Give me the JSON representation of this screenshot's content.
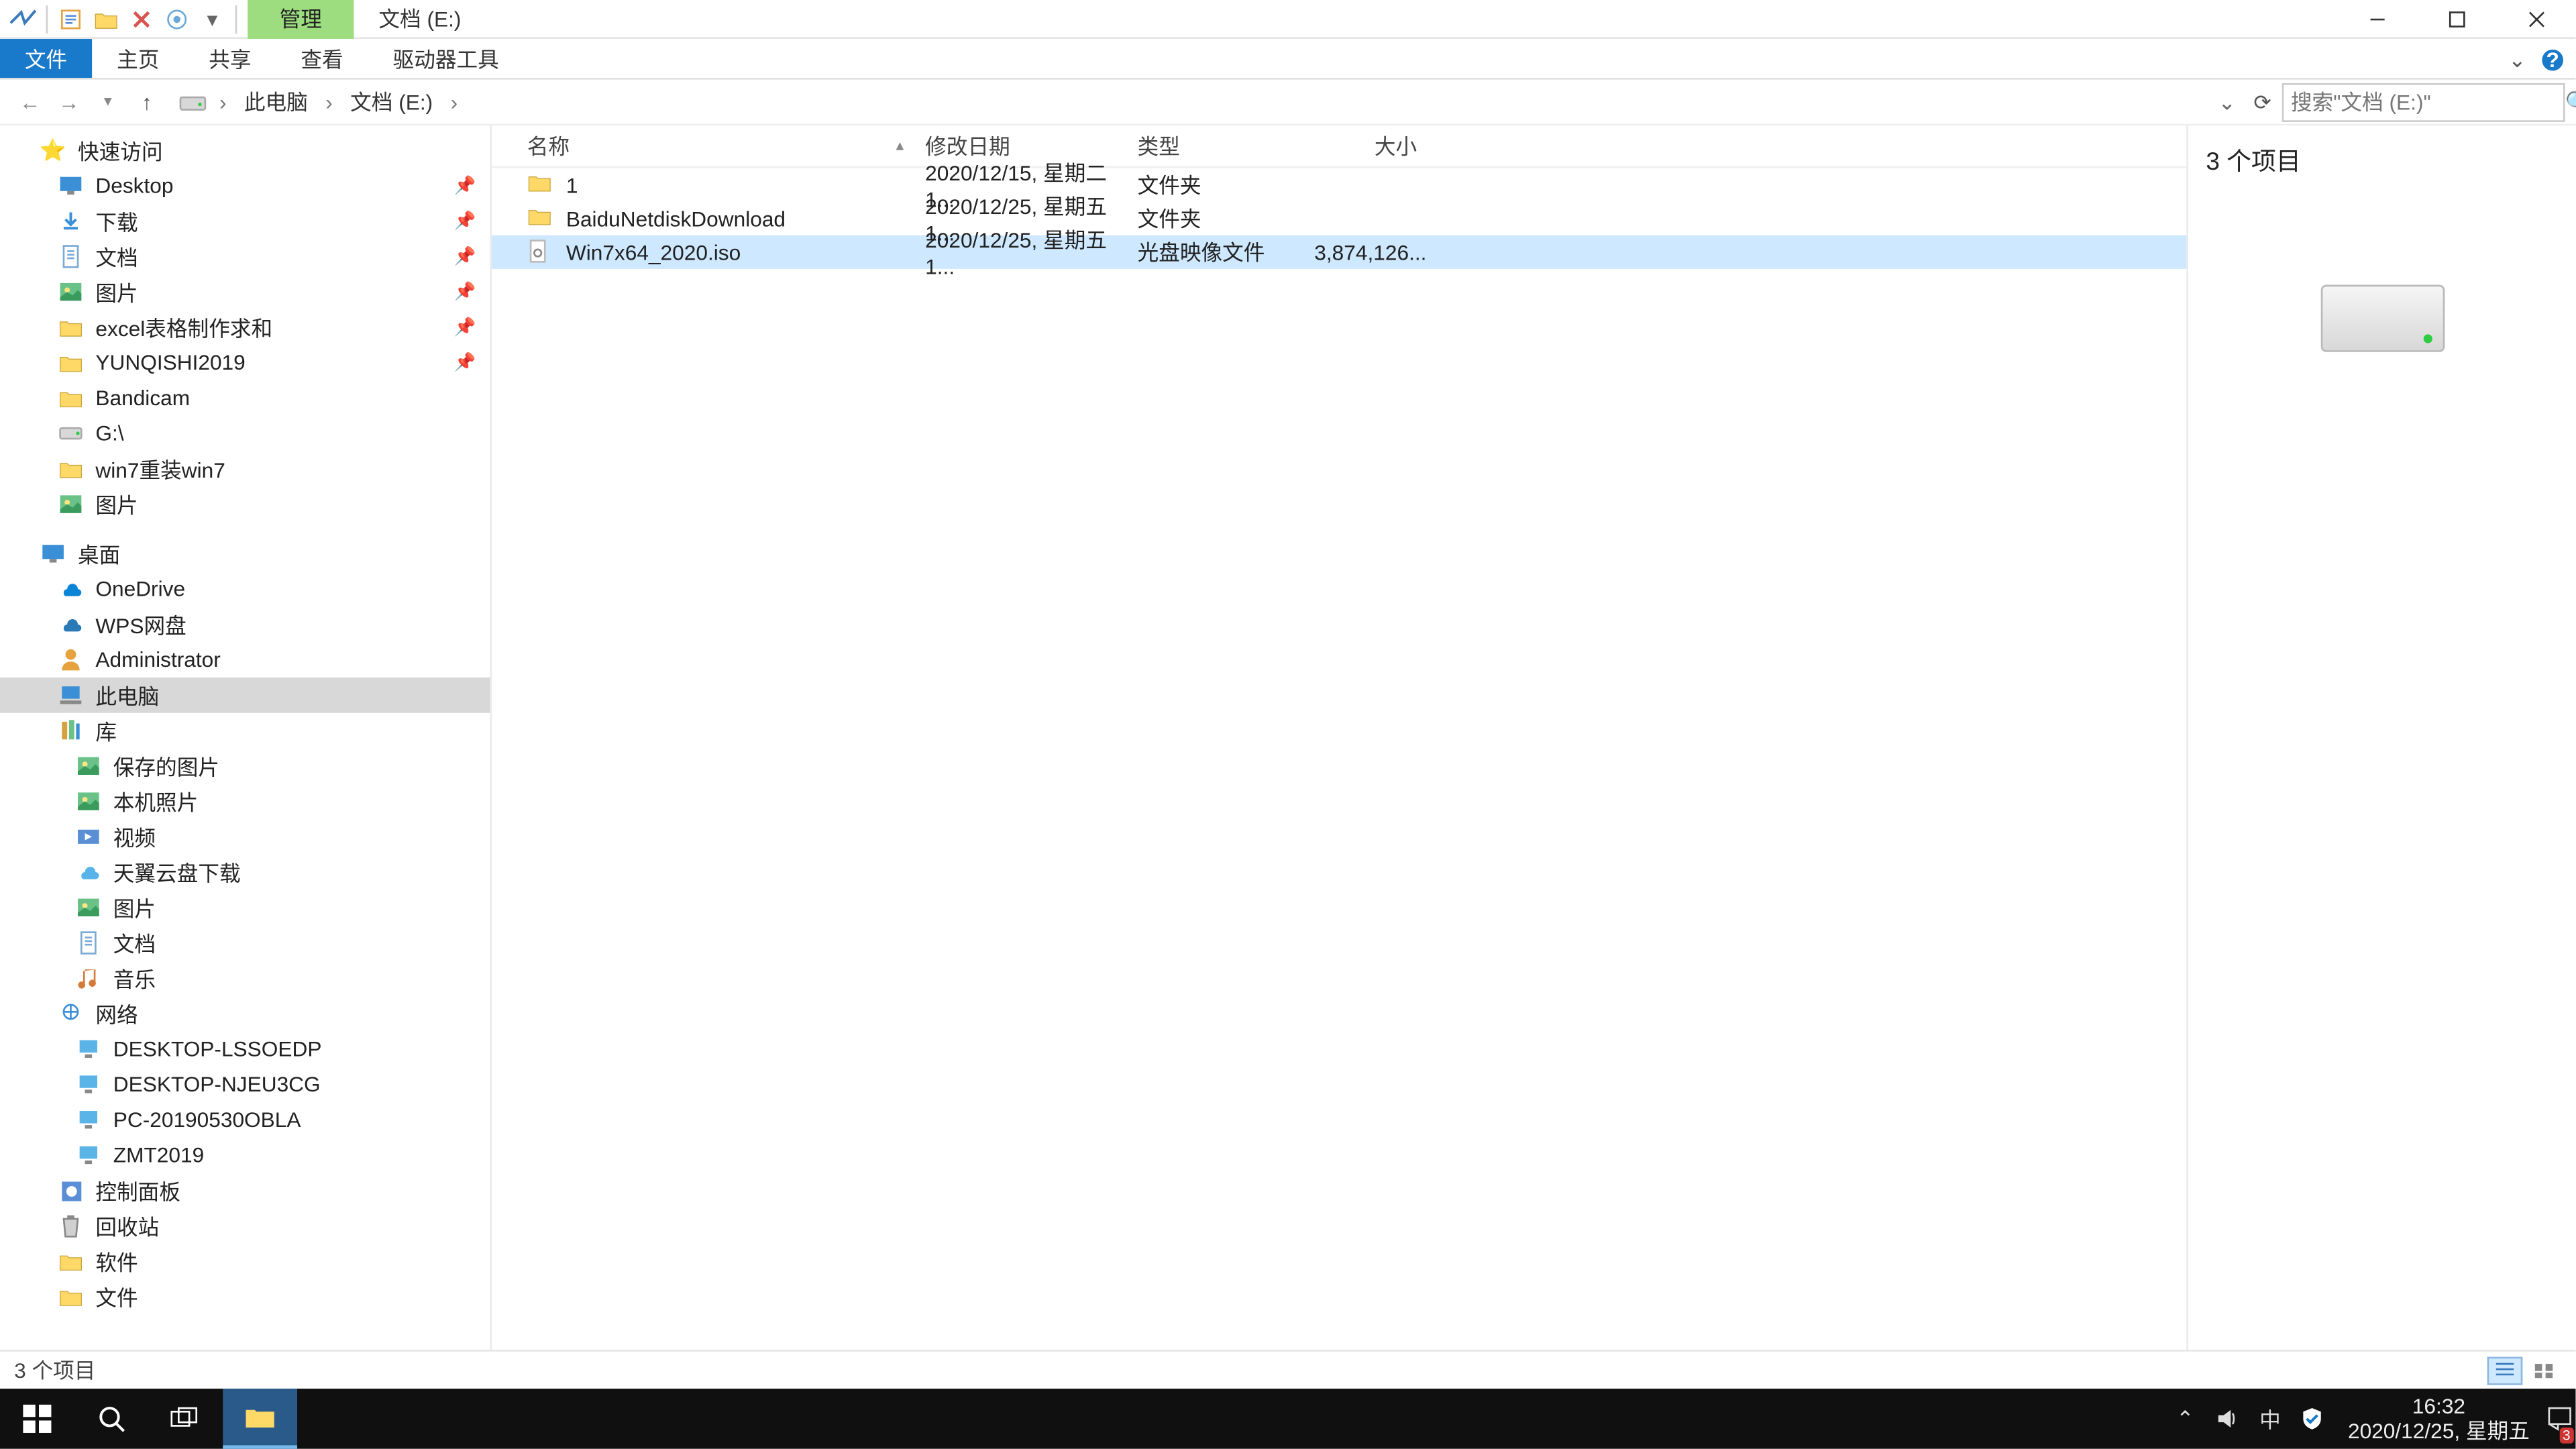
{
  "title": {
    "context_tab": "管理",
    "window_title": "文档 (E:)"
  },
  "ribbon": {
    "file": "文件",
    "tabs": [
      "主页",
      "共享",
      "查看",
      "驱动器工具"
    ]
  },
  "breadcrumbs": [
    "此电脑",
    "文档 (E:)"
  ],
  "search": {
    "placeholder": "搜索\"文档 (E:)\""
  },
  "columns": {
    "name": "名称",
    "date": "修改日期",
    "type": "类型",
    "size": "大小"
  },
  "files": [
    {
      "name": "1",
      "date": "2020/12/15, 星期二 1...",
      "type": "文件夹",
      "size": "",
      "icon": "folder",
      "selected": false
    },
    {
      "name": "BaiduNetdiskDownload",
      "date": "2020/12/25, 星期五 1...",
      "type": "文件夹",
      "size": "",
      "icon": "folder",
      "selected": false
    },
    {
      "name": "Win7x64_2020.iso",
      "date": "2020/12/25, 星期五 1...",
      "type": "光盘映像文件",
      "size": "3,874,126...",
      "icon": "iso",
      "selected": true
    }
  ],
  "nav": {
    "quick": "快速访问",
    "quick_items": [
      {
        "label": "Desktop",
        "icon": "desktop",
        "pin": true
      },
      {
        "label": "下载",
        "icon": "download",
        "pin": true
      },
      {
        "label": "文档",
        "icon": "doc",
        "pin": true
      },
      {
        "label": "图片",
        "icon": "pic",
        "pin": true
      },
      {
        "label": "excel表格制作求和",
        "icon": "folder",
        "pin": true
      },
      {
        "label": "YUNQISHI2019",
        "icon": "folder",
        "pin": true
      },
      {
        "label": "Bandicam",
        "icon": "folder",
        "pin": false
      },
      {
        "label": "G:\\",
        "icon": "drive",
        "pin": false
      },
      {
        "label": "win7重装win7",
        "icon": "folder",
        "pin": false
      },
      {
        "label": "图片",
        "icon": "pic",
        "pin": false
      }
    ],
    "desktop": "桌面",
    "desktop_items": [
      {
        "label": "OneDrive",
        "icon": "onedrive"
      },
      {
        "label": "WPS网盘",
        "icon": "wps"
      },
      {
        "label": "Administrator",
        "icon": "user"
      },
      {
        "label": "此电脑",
        "icon": "pc",
        "selected": true
      },
      {
        "label": "库",
        "icon": "lib"
      }
    ],
    "lib_items": [
      {
        "label": "保存的图片",
        "icon": "pic"
      },
      {
        "label": "本机照片",
        "icon": "pic"
      },
      {
        "label": "视频",
        "icon": "video"
      },
      {
        "label": "天翼云盘下载",
        "icon": "cloud"
      },
      {
        "label": "图片",
        "icon": "pic"
      },
      {
        "label": "文档",
        "icon": "doc"
      },
      {
        "label": "音乐",
        "icon": "music"
      }
    ],
    "network": "网络",
    "network_items": [
      {
        "label": "DESKTOP-LSSOEDP"
      },
      {
        "label": "DESKTOP-NJEU3CG"
      },
      {
        "label": "PC-20190530OBLA"
      },
      {
        "label": "ZMT2019"
      }
    ],
    "extras": [
      {
        "label": "控制面板",
        "icon": "cp"
      },
      {
        "label": "回收站",
        "icon": "bin"
      },
      {
        "label": "软件",
        "icon": "folder"
      },
      {
        "label": "文件",
        "icon": "folder"
      }
    ]
  },
  "preview": {
    "title": "3 个项目"
  },
  "status": {
    "text": "3 个项目"
  },
  "taskbar": {
    "time": "16:32",
    "date": "2020/12/25, 星期五",
    "ime": "中",
    "notif_count": "3"
  }
}
